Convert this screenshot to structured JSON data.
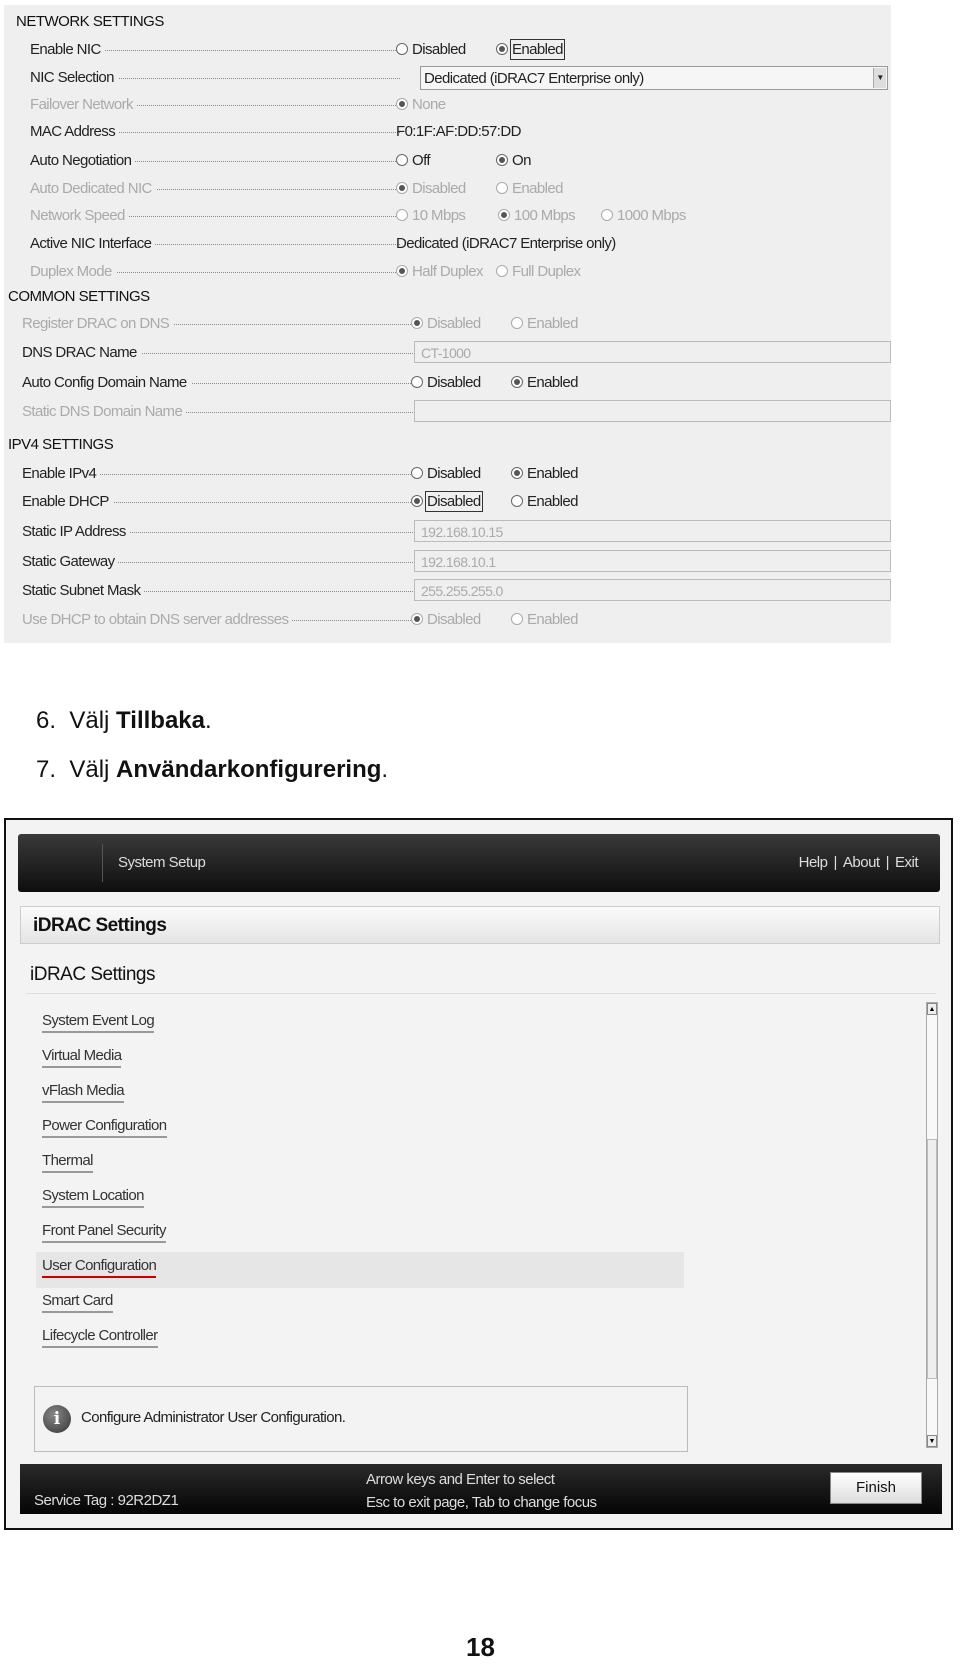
{
  "settings": {
    "network": {
      "title": "NETWORK SETTINGS",
      "rows": [
        {
          "label": "Enable NIC",
          "type": "radio",
          "options": [
            "Disabled",
            "Enabled"
          ],
          "selected": 1,
          "focused": 1
        },
        {
          "label": "NIC Selection",
          "type": "select",
          "value": "Dedicated (iDRAC7 Enterprise only)"
        },
        {
          "label": "Failover Network",
          "type": "radio",
          "disabled": true,
          "options": [
            "None"
          ],
          "selected": 0
        },
        {
          "label": "MAC Address",
          "type": "text",
          "value": "F0:1F:AF:DD:57:DD"
        },
        {
          "label": "Auto Negotiation",
          "type": "radio",
          "options": [
            "Off",
            "On"
          ],
          "selected": 1
        },
        {
          "label": "Auto Dedicated NIC",
          "type": "radio",
          "disabled": true,
          "options": [
            "Disabled",
            "Enabled"
          ],
          "selected": 0
        },
        {
          "label": "Network Speed",
          "type": "radio",
          "disabled": true,
          "options": [
            "10 Mbps",
            "100 Mbps",
            "1000 Mbps"
          ],
          "selected": 1
        },
        {
          "label": "Active NIC Interface",
          "type": "text",
          "value": "Dedicated (iDRAC7 Enterprise only)"
        },
        {
          "label": "Duplex Mode",
          "type": "radio",
          "disabled": true,
          "options": [
            "Half Duplex",
            "Full Duplex"
          ],
          "selected": 0
        }
      ]
    },
    "common": {
      "title": "COMMON SETTINGS",
      "rows": [
        {
          "label": "Register DRAC on DNS",
          "type": "radio",
          "disabled": true,
          "options": [
            "Disabled",
            "Enabled"
          ],
          "selected": 0
        },
        {
          "label": "DNS DRAC Name",
          "type": "field",
          "value": "CT-1000"
        },
        {
          "label": "Auto Config Domain Name",
          "type": "radio",
          "options": [
            "Disabled",
            "Enabled"
          ],
          "selected": 1
        },
        {
          "label": "Static DNS Domain Name",
          "type": "field",
          "disabled": true,
          "value": ""
        }
      ]
    },
    "ipv4": {
      "title": "IPV4 SETTINGS",
      "rows": [
        {
          "label": "Enable IPv4",
          "type": "radio",
          "options": [
            "Disabled",
            "Enabled"
          ],
          "selected": 1
        },
        {
          "label": "Enable DHCP",
          "type": "radio",
          "options": [
            "Disabled",
            "Enabled"
          ],
          "selected": 0,
          "focused": 0
        },
        {
          "label": "Static IP Address",
          "type": "field",
          "value": "192.168.10.15"
        },
        {
          "label": "Static Gateway",
          "type": "field",
          "value": "192.168.10.1"
        },
        {
          "label": "Static Subnet Mask",
          "type": "field",
          "value": "255.255.255.0"
        },
        {
          "label": "Use DHCP to obtain DNS server addresses",
          "type": "radio",
          "disabled": true,
          "options": [
            "Disabled",
            "Enabled"
          ],
          "selected": 0
        }
      ]
    }
  },
  "steps": [
    {
      "num": "6.",
      "text": "Välj ",
      "bold": "Tillbaka",
      "end": "."
    },
    {
      "num": "7.",
      "text": "Välj ",
      "bold": "Användarkonfigurering",
      "end": "."
    }
  ],
  "setup": {
    "title": "System Setup",
    "links": [
      "Help",
      "About",
      "Exit"
    ],
    "header": "iDRAC Settings",
    "subheader": "iDRAC Settings",
    "menu": [
      "System Event Log",
      "Virtual Media",
      "vFlash Media",
      "Power Configuration",
      "Thermal",
      "System Location",
      "Front Panel Security",
      "User Configuration",
      "Smart Card",
      "Lifecycle Controller"
    ],
    "selected_index": 7,
    "info": "Configure Administrator User Configuration.",
    "service_tag": "Service Tag : 92R2DZ1",
    "hint1": "Arrow keys and Enter to select",
    "hint2": "Esc to exit page, Tab to change focus",
    "finish": "Finish",
    "highlight_color": "#cc0000"
  },
  "page_number": "18"
}
